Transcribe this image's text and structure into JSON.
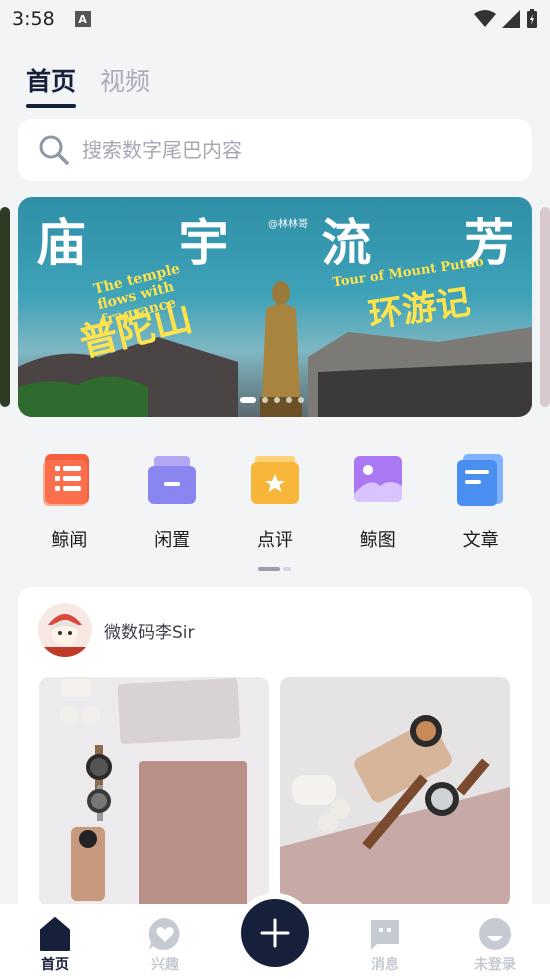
{
  "status_bar": {
    "time": "3:58",
    "a_label": "A"
  },
  "top_tabs": [
    {
      "label": "首页",
      "active": true
    },
    {
      "label": "视频",
      "active": false
    }
  ],
  "search": {
    "placeholder": "搜索数字尾巴内容"
  },
  "banner": {
    "title_chars": [
      "庙",
      "宇",
      "流",
      "芳"
    ],
    "watermark": "@林林哥",
    "sub_left": "The temple flows with fragrance",
    "big_left": "普陀山",
    "sub_right": "Tour of Mount Putuo",
    "big_right": "环游记",
    "page_count": 5,
    "active_index": 0
  },
  "quick_links": [
    {
      "label": "鲸闻",
      "icon": "news-icon",
      "color": "#f4603f"
    },
    {
      "label": "闲置",
      "icon": "box-icon",
      "color": "#8a86f0"
    },
    {
      "label": "点评",
      "icon": "review-icon",
      "color": "#f7b63a"
    },
    {
      "label": "鲸图",
      "icon": "image-icon",
      "color": "#a978f2"
    },
    {
      "label": "文章",
      "icon": "article-icon",
      "color": "#4a8ef0"
    }
  ],
  "post": {
    "author": "微数码李Sir"
  },
  "bottom_nav": [
    {
      "label": "首页",
      "active": true
    },
    {
      "label": "兴趣",
      "active": false
    },
    {
      "label": "消息",
      "active": false
    },
    {
      "label": "未登录",
      "active": false
    }
  ],
  "colors": {
    "primary": "#17203a",
    "inactive": "#c6cad2",
    "background": "#f3f4f6"
  }
}
